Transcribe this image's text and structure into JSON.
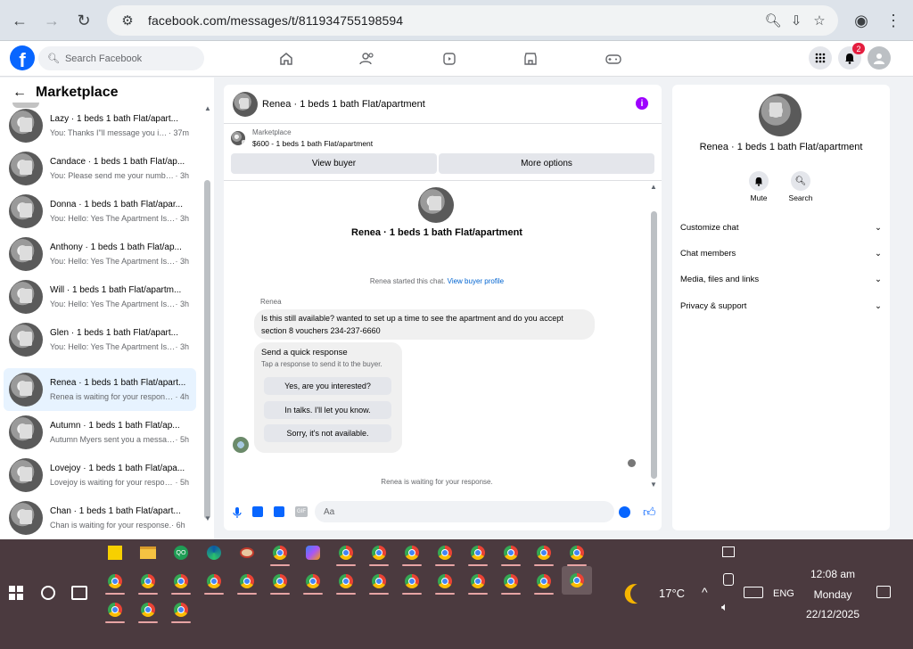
{
  "browser": {
    "url": "facebook.com/messages/t/811934755198594"
  },
  "fb": {
    "search_placeholder": "Search Facebook",
    "notif_count": "2"
  },
  "left": {
    "title": "Marketplace",
    "conversations": [
      {
        "name": "Lazy · 1 beds 1 bath Flat/apart...",
        "preview": "You: Thanks I\"ll message you in ... ",
        "time": "· 37m"
      },
      {
        "name": "Candace · 1 beds 1 bath Flat/ap...",
        "preview": "You: Please send me your number... ",
        "time": "· 3h"
      },
      {
        "name": "Donna · 1 beds 1 bath Flat/apar...",
        "preview": "You: Hello: Yes The Apartment Is S... ",
        "time": "· 3h"
      },
      {
        "name": "Anthony · 1 beds 1 bath Flat/ap...",
        "preview": "You: Hello: Yes The Apartment Is S... ",
        "time": "· 3h"
      },
      {
        "name": "Will · 1 beds 1 bath Flat/apartm...",
        "preview": "You: Hello: Yes The Apartment Is S... ",
        "time": "· 3h"
      },
      {
        "name": "Glen · 1 beds 1 bath Flat/apart...",
        "preview": "You: Hello: Yes The Apartment Is S... ",
        "time": "· 3h"
      },
      {
        "name": "Renea · 1 beds 1 bath Flat/apart...",
        "preview": "Renea is waiting for your response. ",
        "time": "· 4h"
      },
      {
        "name": "Autumn · 1 beds 1 bath Flat/ap...",
        "preview": "Autumn Myers sent you a messag... ",
        "time": "· 5h"
      },
      {
        "name": "Lovejoy · 1 beds 1 bath Flat/apa...",
        "preview": "Lovejoy is waiting for your respon... ",
        "time": "· 5h"
      },
      {
        "name": "Chan · 1 beds 1 bath Flat/apart...",
        "preview": "Chan is waiting for your response. ",
        "time": "· 6h"
      }
    ]
  },
  "chat": {
    "title": "Renea · 1 beds 1 bath Flat/apartment",
    "listing_label": "Marketplace",
    "listing_text": "$600 - 1 beds 1 bath Flat/apartment",
    "view_buyer": "View buyer",
    "more_options": "More options",
    "profile_name": "Renea · 1 beds 1 bath Flat/apartment",
    "started_text": "Renea started this chat.",
    "view_buyer_profile": "View buyer profile",
    "sender": "Renea",
    "message": "Is this still available? wanted to set up a time to see the apartment and do you accept section 8 vouchers 234-237-6660",
    "quick_title": "Send a quick response",
    "quick_sub": "Tap a response to send it to the buyer.",
    "quick_replies": [
      "Yes, are you interested?",
      "In talks. I'll let you know.",
      "Sorry, it's not available."
    ],
    "waiting": "Renea is waiting for your response.",
    "input_placeholder": "Aa"
  },
  "right": {
    "name": "Renea · 1 beds 1 bath Flat/apartment",
    "mute": "Mute",
    "search": "Search",
    "sections": [
      "Customize chat",
      "Chat members",
      "Media, files and links",
      "Privacy & support"
    ]
  },
  "taskbar": {
    "weather": "17°C",
    "lang": "ENG",
    "time": "12:08 am",
    "day": "Monday",
    "date": "22/12/2025"
  }
}
